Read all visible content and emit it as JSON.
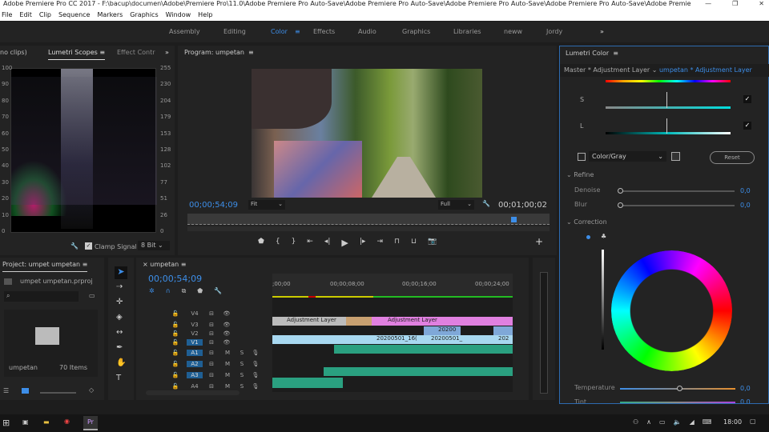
{
  "app": {
    "title": "Adobe Premiere Pro CC 2017 - F:\\bacup\\documen\\Adobe\\Premiere Pro\\11.0\\Adobe Premiere Pro Auto-Save\\Adobe Premiere Pro Auto-Save\\Adobe Premiere Pro Auto-Save\\Adobe Premiere Pro Auto-Save\\Adobe Premie",
    "menu": [
      "File",
      "Edit",
      "Clip",
      "Sequence",
      "Markers",
      "Graphics",
      "Window",
      "Help"
    ],
    "workspaces": [
      "Assembly",
      "Editing",
      "Color",
      "Effects",
      "Audio",
      "Graphics",
      "Libraries",
      "neww",
      "Jordy"
    ],
    "active_workspace": "Color",
    "more": "»"
  },
  "scopes": {
    "tabs": [
      "no clips)",
      "Lumetri Scopes",
      "Effect Contr"
    ],
    "left_scale": [
      "100",
      "90",
      "80",
      "70",
      "60",
      "50",
      "40",
      "30",
      "20",
      "10",
      "0"
    ],
    "right_scale": [
      "255",
      "230",
      "204",
      "179",
      "153",
      "128",
      "102",
      "77",
      "51",
      "26",
      "0"
    ],
    "clamp_label": "Clamp Signal",
    "bit_depth": "8 Bit"
  },
  "program": {
    "title": "Program: umpetan",
    "timecode": "00;00;54;09",
    "fit": "Fit",
    "quality": "Full",
    "duration": "00;01;00;02",
    "playhead_fraction": 0.9
  },
  "lumetri": {
    "title": "Lumetri Color",
    "master": "Master * Adjustment Layer",
    "clip": "umpetan * Adjustment Layer",
    "s_label": "S",
    "l_label": "L",
    "color_gray": "Color/Gray",
    "reset": "Reset",
    "refine": "Refine",
    "denoise_label": "Denoise",
    "denoise": "0,0",
    "blur_label": "Blur",
    "blur": "0,0",
    "correction": "Correction",
    "temperature_label": "Temperature",
    "temperature": "0,0",
    "tint_label": "Tint",
    "tint": "0,0"
  },
  "project": {
    "title": "Project: umpet umpetan",
    "file": "umpet umpetan.prproj",
    "bin": "umpetan",
    "items": "70 Items"
  },
  "timeline": {
    "title": "umpetan",
    "timecode": "00;00;54;09",
    "ruler": [
      ";00;00",
      "00;00;08;00",
      "00;00;16;00",
      "00;00;24;00"
    ],
    "video_tracks": [
      "V4",
      "V3",
      "V2",
      "V1"
    ],
    "audio_tracks": [
      "A1",
      "A2",
      "A3",
      "A4"
    ],
    "m": "M",
    "s": "S",
    "clips": {
      "v3a": "Adjustment Layer",
      "v3b": "Adjustment Layer",
      "v2": "20200",
      "v1a": "20200501_16(",
      "v1b": "20200501_",
      "v1c": "202"
    }
  },
  "taskbar": {
    "time": "18:00"
  }
}
